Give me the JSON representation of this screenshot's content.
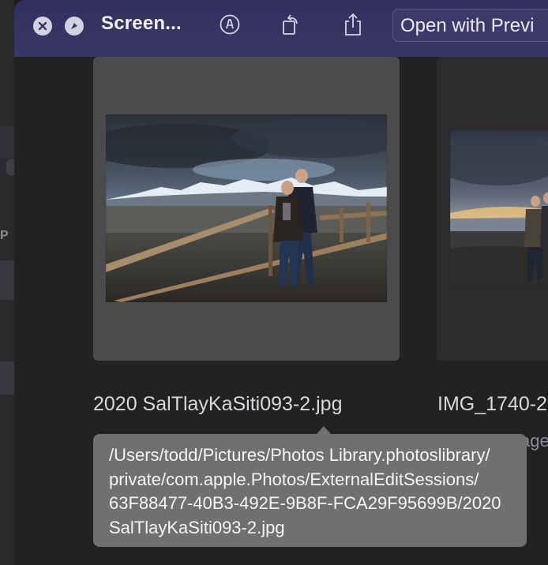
{
  "window": {
    "title": "Screen...",
    "open_with_label": "Open with Previ"
  },
  "toolbar_icons": {
    "close": "close-circle-icon",
    "fullscreen": "compass-circle-icon",
    "markup": "markup-pen-icon",
    "rotate": "rotate-icon",
    "share": "share-icon"
  },
  "items": [
    {
      "filename": "2020 SalTlayKaSiti093-2.jpg",
      "meta": "",
      "image": "couple-on-fence-mountain-photo"
    },
    {
      "filename": "IMG_1740-2.",
      "meta": "age",
      "image": "couple-on-beach-photo"
    }
  ],
  "tooltip": {
    "lines": [
      "/Users/todd/Pictures/Photos Library.photoslibrary/",
      "private/com.apple.Photos/ExternalEditSessions/",
      "63F88477-40B3-492E-9B8F-FCA29F95699B/2020",
      "SalTlayKaSiti093-2.jpg"
    ]
  },
  "background_window": {
    "partial_text": "P"
  },
  "colors": {
    "titlebar": "#383463",
    "panel": "#222225",
    "tooltip": "#707070"
  }
}
